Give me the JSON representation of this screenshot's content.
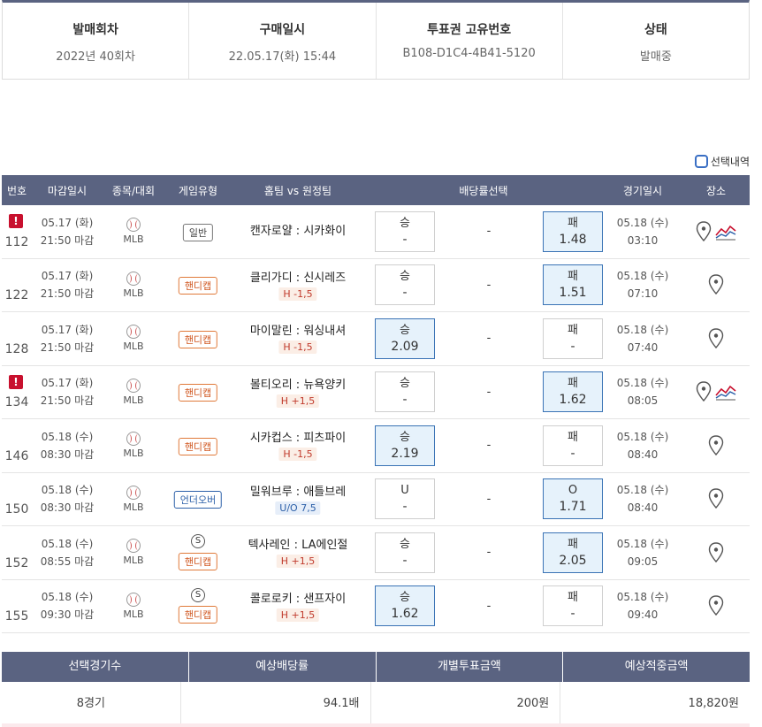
{
  "info": {
    "headers": [
      "발매회차",
      "구매일시",
      "투표권 고유번호",
      "상태"
    ],
    "values": [
      "2022년 40회차",
      "22.05.17(화) 15:44",
      "B108-D1C4-4B41-5120",
      "발매중"
    ]
  },
  "selection_toggle": "선택내역",
  "table": {
    "headers": [
      "번호",
      "마감일시",
      "종목/대회",
      "게임유형",
      "홈팀 vs 원정팀",
      "배당률선택",
      "경기일시",
      "장소"
    ],
    "rows": [
      {
        "no": "112",
        "warn": true,
        "deadline_date": "05.17 (화)",
        "deadline_time": "21:50 마감",
        "sport": "MLB",
        "game_type": "일반",
        "type_class": "gen",
        "special": "",
        "match": "캔자로얄 : 시카화이",
        "line": "",
        "line_class": "",
        "left_label": "승",
        "left_val": "-",
        "draw": "-",
        "right_label": "패",
        "right_val": "1.48",
        "selected": "right",
        "game_date": "05.18 (수)",
        "game_time": "03:10",
        "chart": true
      },
      {
        "no": "122",
        "warn": false,
        "deadline_date": "05.17 (화)",
        "deadline_time": "21:50 마감",
        "sport": "MLB",
        "game_type": "핸디캡",
        "type_class": "hc",
        "special": "",
        "match": "클리가디 : 신시레즈",
        "line": "H -1,5",
        "line_class": "h",
        "left_label": "승",
        "left_val": "-",
        "draw": "-",
        "right_label": "패",
        "right_val": "1.51",
        "selected": "right",
        "game_date": "05.18 (수)",
        "game_time": "07:10",
        "chart": false
      },
      {
        "no": "128",
        "warn": false,
        "deadline_date": "05.17 (화)",
        "deadline_time": "21:50 마감",
        "sport": "MLB",
        "game_type": "핸디캡",
        "type_class": "hc",
        "special": "",
        "match": "마이말린 : 워싱내셔",
        "line": "H -1,5",
        "line_class": "h",
        "left_label": "승",
        "left_val": "2.09",
        "draw": "-",
        "right_label": "패",
        "right_val": "-",
        "selected": "left",
        "game_date": "05.18 (수)",
        "game_time": "07:40",
        "chart": false
      },
      {
        "no": "134",
        "warn": true,
        "deadline_date": "05.17 (화)",
        "deadline_time": "21:50 마감",
        "sport": "MLB",
        "game_type": "핸디캡",
        "type_class": "hc",
        "special": "",
        "match": "볼티오리 : 뉴욕양키",
        "line": "H +1,5",
        "line_class": "h",
        "left_label": "승",
        "left_val": "-",
        "draw": "-",
        "right_label": "패",
        "right_val": "1.62",
        "selected": "right",
        "game_date": "05.18 (수)",
        "game_time": "08:05",
        "chart": true
      },
      {
        "no": "146",
        "warn": false,
        "deadline_date": "05.18 (수)",
        "deadline_time": "08:30 마감",
        "sport": "MLB",
        "game_type": "핸디캡",
        "type_class": "hc",
        "special": "",
        "match": "시카컵스 : 피츠파이",
        "line": "H -1,5",
        "line_class": "h",
        "left_label": "승",
        "left_val": "2.19",
        "draw": "-",
        "right_label": "패",
        "right_val": "-",
        "selected": "left",
        "game_date": "05.18 (수)",
        "game_time": "08:40",
        "chart": false
      },
      {
        "no": "150",
        "warn": false,
        "deadline_date": "05.18 (수)",
        "deadline_time": "08:30 마감",
        "sport": "MLB",
        "game_type": "언더오버",
        "type_class": "ou",
        "special": "",
        "match": "밀워브루 : 애틀브레",
        "line": "U/O 7,5",
        "line_class": "ou",
        "left_label": "U",
        "left_val": "-",
        "draw": "-",
        "right_label": "O",
        "right_val": "1.71",
        "selected": "right",
        "game_date": "05.18 (수)",
        "game_time": "08:40",
        "chart": false
      },
      {
        "no": "152",
        "warn": false,
        "deadline_date": "05.18 (수)",
        "deadline_time": "08:55 마감",
        "sport": "MLB",
        "game_type": "핸디캡",
        "type_class": "hc",
        "special": "S",
        "match": "텍사레인 : LA에인절",
        "line": "H +1,5",
        "line_class": "h",
        "left_label": "승",
        "left_val": "-",
        "draw": "-",
        "right_label": "패",
        "right_val": "2.05",
        "selected": "right",
        "game_date": "05.18 (수)",
        "game_time": "09:05",
        "chart": false
      },
      {
        "no": "155",
        "warn": false,
        "deadline_date": "05.18 (수)",
        "deadline_time": "09:30 마감",
        "sport": "MLB",
        "game_type": "핸디캡",
        "type_class": "hc",
        "special": "S",
        "match": "콜로로키 : 샌프자이",
        "line": "H +1,5",
        "line_class": "h",
        "left_label": "승",
        "left_val": "1.62",
        "draw": "-",
        "right_label": "패",
        "right_val": "-",
        "selected": "left",
        "game_date": "05.18 (수)",
        "game_time": "09:40",
        "chart": false
      }
    ]
  },
  "summary": {
    "headers": [
      "선택경기수",
      "예상배당률",
      "개별투표금액",
      "예상적중금액"
    ],
    "values": [
      "8경기",
      "94.1배",
      "200원",
      "18,820원"
    ]
  },
  "colors": {
    "header_bg": "#5a6381",
    "selected_bg": "#e6f2fb",
    "warn": "#c8102e",
    "handicap": "#d0561f",
    "underover": "#2b5fa8"
  }
}
